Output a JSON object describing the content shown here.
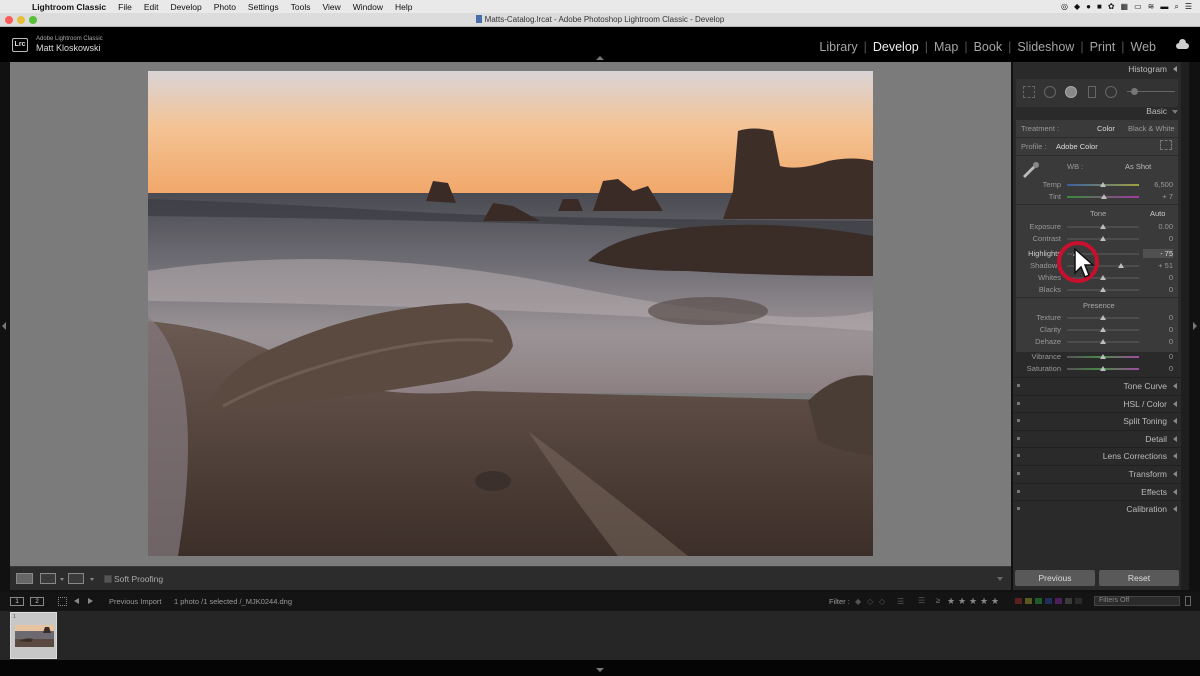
{
  "mac_menu": {
    "apple_glyph": "",
    "items": [
      "Lightroom Classic",
      "File",
      "Edit",
      "Develop",
      "Photo",
      "Settings",
      "Tools",
      "View",
      "Window",
      "Help"
    ]
  },
  "window": {
    "title": "Matts-Catalog.lrcat - Adobe Photoshop Lightroom Classic - Develop"
  },
  "identity": {
    "badge": "Lrc",
    "brand": "Adobe Lightroom Classic",
    "user": "Matt Kloskowski"
  },
  "modules": {
    "items": [
      "Library",
      "Develop",
      "Map",
      "Book",
      "Slideshow",
      "Print",
      "Web"
    ],
    "separator": "|",
    "active": "Develop"
  },
  "panels": {
    "histogram": "Histogram",
    "basic": "Basic",
    "treatment": {
      "label": "Treatment :",
      "color": "Color",
      "bw": "Black & White"
    },
    "profile": {
      "label": "Profile :",
      "value": "Adobe Color"
    },
    "wb": {
      "label": "WB :",
      "value": "As Shot"
    },
    "wb_sliders": [
      {
        "label": "Temp",
        "value": "6,500",
        "pos": 0.5
      },
      {
        "label": "Tint",
        "value": "+ 7",
        "pos": 0.52
      }
    ],
    "tone": {
      "label": "Tone",
      "auto": "Auto"
    },
    "tone_sliders": [
      {
        "label": "Exposure",
        "value": "0.00",
        "pos": 0.5
      },
      {
        "label": "Contrast",
        "value": "0",
        "pos": 0.5
      },
      {
        "label": "Highlights",
        "value": "- 75",
        "pos": 0.12
      },
      {
        "label": "Shadows",
        "value": "+ 51",
        "pos": 0.75
      },
      {
        "label": "Whites",
        "value": "0",
        "pos": 0.5
      },
      {
        "label": "Blacks",
        "value": "0",
        "pos": 0.5
      }
    ],
    "presence": {
      "label": "Presence"
    },
    "presence_sliders": [
      {
        "label": "Texture",
        "value": "0",
        "pos": 0.5
      },
      {
        "label": "Clarity",
        "value": "0",
        "pos": 0.5
      },
      {
        "label": "Dehaze",
        "value": "0",
        "pos": 0.5
      },
      {
        "label": "Vibrance",
        "value": "0",
        "pos": 0.5
      },
      {
        "label": "Saturation",
        "value": "0",
        "pos": 0.5
      }
    ],
    "collapsed": [
      "Tone Curve",
      "HSL / Color",
      "Split Toning",
      "Detail",
      "Lens Corrections",
      "Transform",
      "Effects",
      "Calibration"
    ]
  },
  "buttons": {
    "previous": "Previous",
    "reset": "Reset"
  },
  "toolbar": {
    "soft_proofing": "Soft Proofing"
  },
  "filmstrip_bar": {
    "view1": "1",
    "view2": "2",
    "source": "Previous Import",
    "info": "1 photo /1 selected /_MJK0244.dng",
    "filter_label": "Filter :",
    "filters_value": "Filters Off",
    "stars": [
      "★",
      "★",
      "★",
      "★",
      "★"
    ],
    "thumb_index": "1"
  },
  "colors": {
    "accent": "#d9d9d9",
    "panel_bg": "#2a2a2a",
    "section_bg": "#3a3a3a",
    "canvas_bg": "#7b7b7b",
    "cursor_circle": "#c8102e"
  },
  "icons": {
    "cursor": "arrow-cursor-icon",
    "eyedropper": "eyedropper-icon",
    "cloud": "cloud-icon",
    "profile_browser": "grid-icon"
  }
}
